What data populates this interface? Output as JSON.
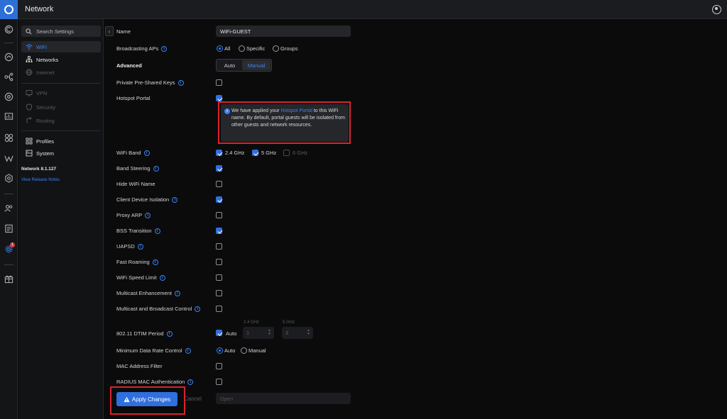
{
  "app": {
    "title": "Network"
  },
  "sidebar": {
    "search_placeholder": "Search Settings",
    "items": [
      {
        "label": "WiFi",
        "icon": "wifi-icon",
        "state": "active"
      },
      {
        "label": "Networks",
        "icon": "networks-icon",
        "state": "normal"
      },
      {
        "label": "Internet",
        "icon": "globe-icon",
        "state": "disabled"
      },
      {
        "label": "VPN",
        "icon": "vpn-icon",
        "state": "disabled"
      },
      {
        "label": "Security",
        "icon": "shield-icon",
        "state": "disabled"
      },
      {
        "label": "Routing",
        "icon": "routing-icon",
        "state": "disabled"
      },
      {
        "label": "Profiles",
        "icon": "profiles-icon",
        "state": "normal"
      },
      {
        "label": "System",
        "icon": "system-icon",
        "state": "normal"
      }
    ],
    "version": "Network 8.1.127",
    "release_notes": "View Release Notes"
  },
  "rail": {
    "notification_count": "1"
  },
  "form": {
    "name_label": "Name",
    "name_value": "WiFi-GUEST",
    "broadcasting_label": "Broadcasting APs",
    "broadcasting_options": [
      "All",
      "Specific",
      "Groups"
    ],
    "advanced_label": "Advanced",
    "advanced_options": [
      "Auto",
      "Manual"
    ],
    "ppsk_label": "Private Pre-Shared Keys",
    "hotspot_label": "Hotspot Portal",
    "notice_before": "We have applied your ",
    "notice_link": "Hotspot Portal",
    "notice_after": " to this WiFi name. By default, portal guests will be isolated from other guests and network resources.",
    "band_label": "WiFi Band",
    "bands": [
      "2.4 GHz",
      "5 GHz",
      "6 GHz"
    ],
    "band_steering_label": "Band Steering",
    "hide_name_label": "Hide WiFi Name",
    "client_isolation_label": "Client Device Isolation",
    "proxy_arp_label": "Proxy ARP",
    "bss_label": "BSS Transition",
    "uapsd_label": "UAPSD",
    "fast_roaming_label": "Fast Roaming",
    "speed_limit_label": "WiFi Speed Limit",
    "multicast_enh_label": "Multicast Enhancement",
    "multicast_bc_label": "Multicast and Broadcast Control",
    "dtim_label": "802.11 DTIM Period",
    "dtim_auto": "Auto",
    "dtim_24_label": "2.4 GHz",
    "dtim_24_value": "1",
    "dtim_5_label": "5 GHz",
    "dtim_5_value": "3",
    "min_rate_label": "Minimum Data Rate Control",
    "min_rate_options": [
      "Auto",
      "Manual"
    ],
    "mac_filter_label": "MAC Address Filter",
    "radius_label": "RADIUS MAC Authentication",
    "radius_select": "Open",
    "apply_label": "Apply Changes",
    "cancel_label": "Cancel"
  },
  "colors": {
    "accent": "#2f6fde",
    "highlight_box": "#d9242f",
    "background": "#0b0b0c"
  }
}
